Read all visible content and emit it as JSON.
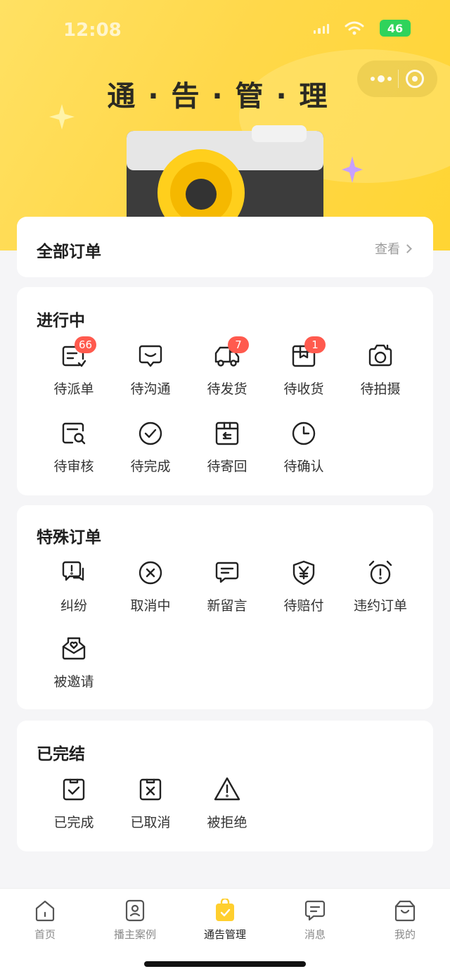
{
  "status_bar": {
    "time": "12:08",
    "battery": "46"
  },
  "hero": {
    "title": "通 · 告 · 管 · 理"
  },
  "all_orders": {
    "title": "全部订单",
    "view_label": "查看"
  },
  "in_progress": {
    "title": "进行中",
    "items": [
      {
        "label": "待派单",
        "icon": "dispatch-order-icon",
        "badge": "66"
      },
      {
        "label": "待沟通",
        "icon": "chat-icon",
        "badge": ""
      },
      {
        "label": "待发货",
        "icon": "truck-icon",
        "badge": "7"
      },
      {
        "label": "待收货",
        "icon": "package-icon",
        "badge": "1"
      },
      {
        "label": "待拍摄",
        "icon": "camera-icon",
        "badge": ""
      },
      {
        "label": "待审核",
        "icon": "review-icon",
        "badge": ""
      },
      {
        "label": "待完成",
        "icon": "check-circle-icon",
        "badge": ""
      },
      {
        "label": "待寄回",
        "icon": "return-box-icon",
        "badge": ""
      },
      {
        "label": "待确认",
        "icon": "clock-icon",
        "badge": ""
      }
    ]
  },
  "special_orders": {
    "title": "特殊订单",
    "items": [
      {
        "label": "纠纷",
        "icon": "dispute-icon"
      },
      {
        "label": "取消中",
        "icon": "cancel-circle-icon"
      },
      {
        "label": "新留言",
        "icon": "message-icon"
      },
      {
        "label": "待赔付",
        "icon": "compensation-shield-icon"
      },
      {
        "label": "违约订单",
        "icon": "alarm-clock-icon"
      },
      {
        "label": "被邀请",
        "icon": "invitation-envelope-icon"
      }
    ]
  },
  "finished": {
    "title": "已完结",
    "items": [
      {
        "label": "已完成",
        "icon": "completed-clipboard-icon"
      },
      {
        "label": "已取消",
        "icon": "cancelled-clipboard-icon"
      },
      {
        "label": "被拒绝",
        "icon": "warning-triangle-icon"
      }
    ]
  },
  "tabbar": {
    "items": [
      {
        "label": "首页",
        "icon": "home-icon",
        "active": false
      },
      {
        "label": "播主案例",
        "icon": "portfolio-icon",
        "active": false
      },
      {
        "label": "通告管理",
        "icon": "notice-bag-icon",
        "active": true
      },
      {
        "label": "消息",
        "icon": "message-tab-icon",
        "active": false
      },
      {
        "label": "我的",
        "icon": "profile-icon",
        "active": false
      }
    ]
  },
  "colors": {
    "brand_yellow": "#ffd84a",
    "badge_red": "#ff5a4e",
    "battery_green": "#2fd35b"
  }
}
